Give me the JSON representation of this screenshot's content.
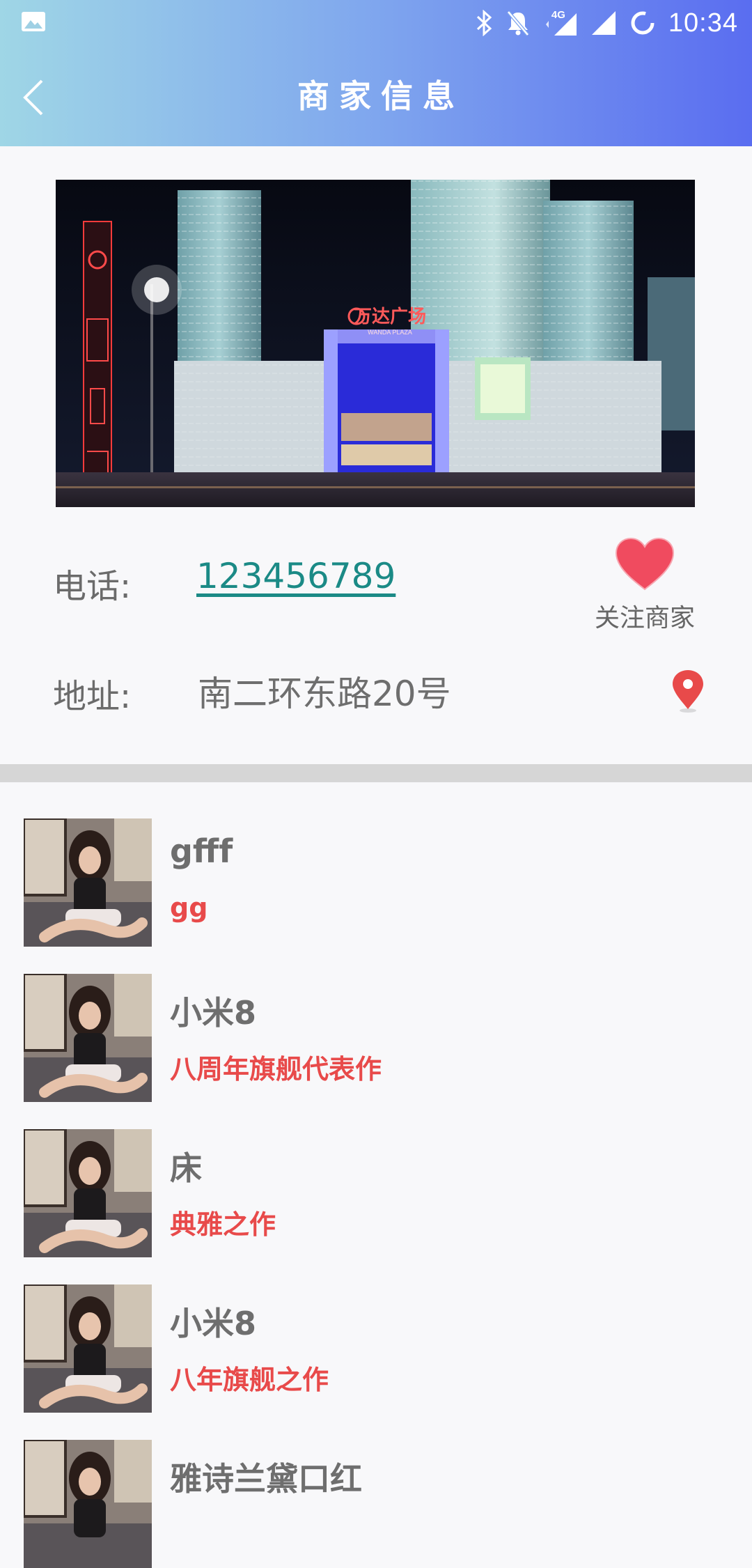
{
  "status_bar": {
    "time": "10:34",
    "network": "4G"
  },
  "nav": {
    "title": "商家信息"
  },
  "hero": {
    "sign_text": "万达广场",
    "sign_subtext": "WANDA PLAZA"
  },
  "merchant": {
    "phone_label": "电话:",
    "phone_value": "123456789",
    "address_label": "地址:",
    "address_value": "南二环东路20号",
    "follow_label": "关注商家"
  },
  "colors": {
    "accent_red": "#e84a4a",
    "link_teal": "#1b8a86",
    "heart": "#f04b5f"
  },
  "products": [
    {
      "name": "gfff",
      "desc": "gg"
    },
    {
      "name": "小米8",
      "desc": "八周年旗舰代表作"
    },
    {
      "name": "床",
      "desc": "典雅之作"
    },
    {
      "name": "小米8",
      "desc": "八年旗舰之作"
    },
    {
      "name": "雅诗兰黛口红",
      "desc": ""
    }
  ]
}
